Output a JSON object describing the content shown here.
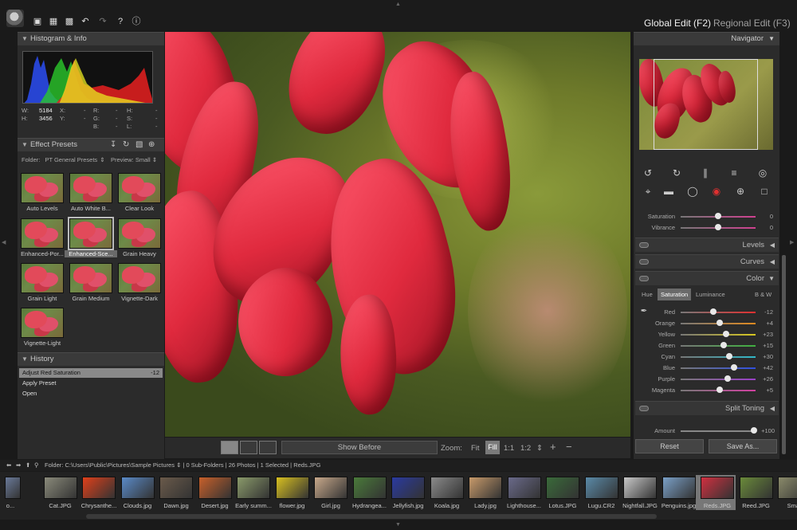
{
  "toolbar": {
    "icons": [
      "app-logo",
      "open-icon",
      "save-icon",
      "save-as-icon",
      "undo-icon",
      "redo-icon",
      "help-icon",
      "info-icon"
    ]
  },
  "modes": {
    "global": "Global Edit (F2)",
    "regional": "Regional Edit (F3)"
  },
  "histogram": {
    "title": "Histogram & Info",
    "w_label": "W:",
    "w_value": "5184",
    "h_label": "H:",
    "h_value": "3456",
    "x_label": "X:",
    "x_value": "-",
    "y_label": "Y:",
    "y_value": "-",
    "r_label": "R:",
    "r_value": "-",
    "g_label": "G:",
    "g_value": "-",
    "b_label": "B:",
    "b_value": "-",
    "hh_label": "H:",
    "hh_value": "-",
    "s_label": "S:",
    "s_value": "-",
    "l_label": "L:",
    "l_value": "-"
  },
  "presets": {
    "title": "Effect Presets",
    "folder_label": "Folder:",
    "folder_value": "PT General Presets",
    "preview_label": "Preview:",
    "preview_value": "Small",
    "items": [
      "Auto Levels",
      "Auto White B...",
      "Clear Look",
      "Enhanced-Por...",
      "Enhanced-Sce...",
      "Grain Heavy",
      "Grain Light",
      "Grain Medium",
      "Vignette-Dark",
      "Vignette-Light"
    ],
    "selected_index": 4
  },
  "history": {
    "title": "History",
    "items": [
      {
        "label": "Adjust Red Saturation",
        "value": "-12"
      },
      {
        "label": "Apply Preset",
        "value": ""
      },
      {
        "label": "Open",
        "value": ""
      }
    ]
  },
  "bottom_tools": {
    "show_before": "Show Before",
    "zoom_label": "Zoom:",
    "fit": "Fit",
    "fill": "Fill",
    "one_one": "1:1",
    "one_two": "1:2",
    "plus": "+",
    "minus": "−"
  },
  "navigator": {
    "title": "Navigator"
  },
  "adjust": {
    "saturation": {
      "label": "Saturation",
      "value": "0"
    },
    "vibrance": {
      "label": "Vibrance",
      "value": "0"
    }
  },
  "sections": {
    "levels": "Levels",
    "curves": "Curves",
    "color": "Color",
    "split_toning": "Split Toning"
  },
  "color_tabs": {
    "hue": "Hue",
    "saturation": "Saturation",
    "luminance": "Luminance",
    "bw": "B & W"
  },
  "color_sliders": [
    {
      "label": "Red",
      "value": "-12",
      "pos": 0.44,
      "color": "#e03030"
    },
    {
      "label": "Orange",
      "value": "+4",
      "pos": 0.52,
      "color": "#e08a20"
    },
    {
      "label": "Yellow",
      "value": "+23",
      "pos": 0.61,
      "color": "#d8c820"
    },
    {
      "label": "Green",
      "value": "+15",
      "pos": 0.57,
      "color": "#40b040"
    },
    {
      "label": "Cyan",
      "value": "+30",
      "pos": 0.65,
      "color": "#30b8c8"
    },
    {
      "label": "Blue",
      "value": "+42",
      "pos": 0.71,
      "color": "#3050e0"
    },
    {
      "label": "Purple",
      "value": "+26",
      "pos": 0.63,
      "color": "#9a40c8"
    },
    {
      "label": "Magenta",
      "value": "+5",
      "pos": 0.52,
      "color": "#d040a0"
    }
  ],
  "amount": {
    "label": "Amount",
    "value": "+100"
  },
  "buttons": {
    "reset": "Reset",
    "save_as": "Save As..."
  },
  "pathbar": {
    "folder_label": "Folder:",
    "path": "C:\\Users\\Public\\Pictures\\Sample Pictures",
    "subfolders": "0 Sub-Folders",
    "photos": "26 Photos",
    "selected": "1 Selected",
    "current": "Reds.JPG"
  },
  "filmstrip": [
    {
      "name": "o...",
      "color": "#6a7a9a"
    },
    {
      "name": "Cat.JPG",
      "color": "#8a8a7a"
    },
    {
      "name": "Chrysanthe...",
      "color": "#e0401a"
    },
    {
      "name": "Clouds.jpg",
      "color": "#5a8ac8"
    },
    {
      "name": "Dawn.jpg",
      "color": "#6a5a4a"
    },
    {
      "name": "Desert.jpg",
      "color": "#c8602a"
    },
    {
      "name": "Early summ...",
      "color": "#8a9a6a"
    },
    {
      "name": "flower.jpg",
      "color": "#d8c020"
    },
    {
      "name": "Girl.jpg",
      "color": "#c8a88a"
    },
    {
      "name": "Hydrangea...",
      "color": "#4a7a3a"
    },
    {
      "name": "Jellyfish.jpg",
      "color": "#2a3aa0"
    },
    {
      "name": "Koala.jpg",
      "color": "#8a8a8a"
    },
    {
      "name": "Lady.jpg",
      "color": "#c89a6a"
    },
    {
      "name": "Lighthouse...",
      "color": "#6a6a8a"
    },
    {
      "name": "Lotus.JPG",
      "color": "#3a6a3a"
    },
    {
      "name": "Lugu.CR2",
      "color": "#5a8aa8"
    },
    {
      "name": "Nightfall.JPG",
      "color": "#c8c8c8"
    },
    {
      "name": "Penguins.jpg",
      "color": "#7aa0c8"
    },
    {
      "name": "Reds.JPG",
      "color": "#d03040"
    },
    {
      "name": "Reed.JPG",
      "color": "#6a8a3a"
    },
    {
      "name": "Small",
      "color": "#8a8a6a"
    }
  ],
  "filmstrip_selected": 18
}
